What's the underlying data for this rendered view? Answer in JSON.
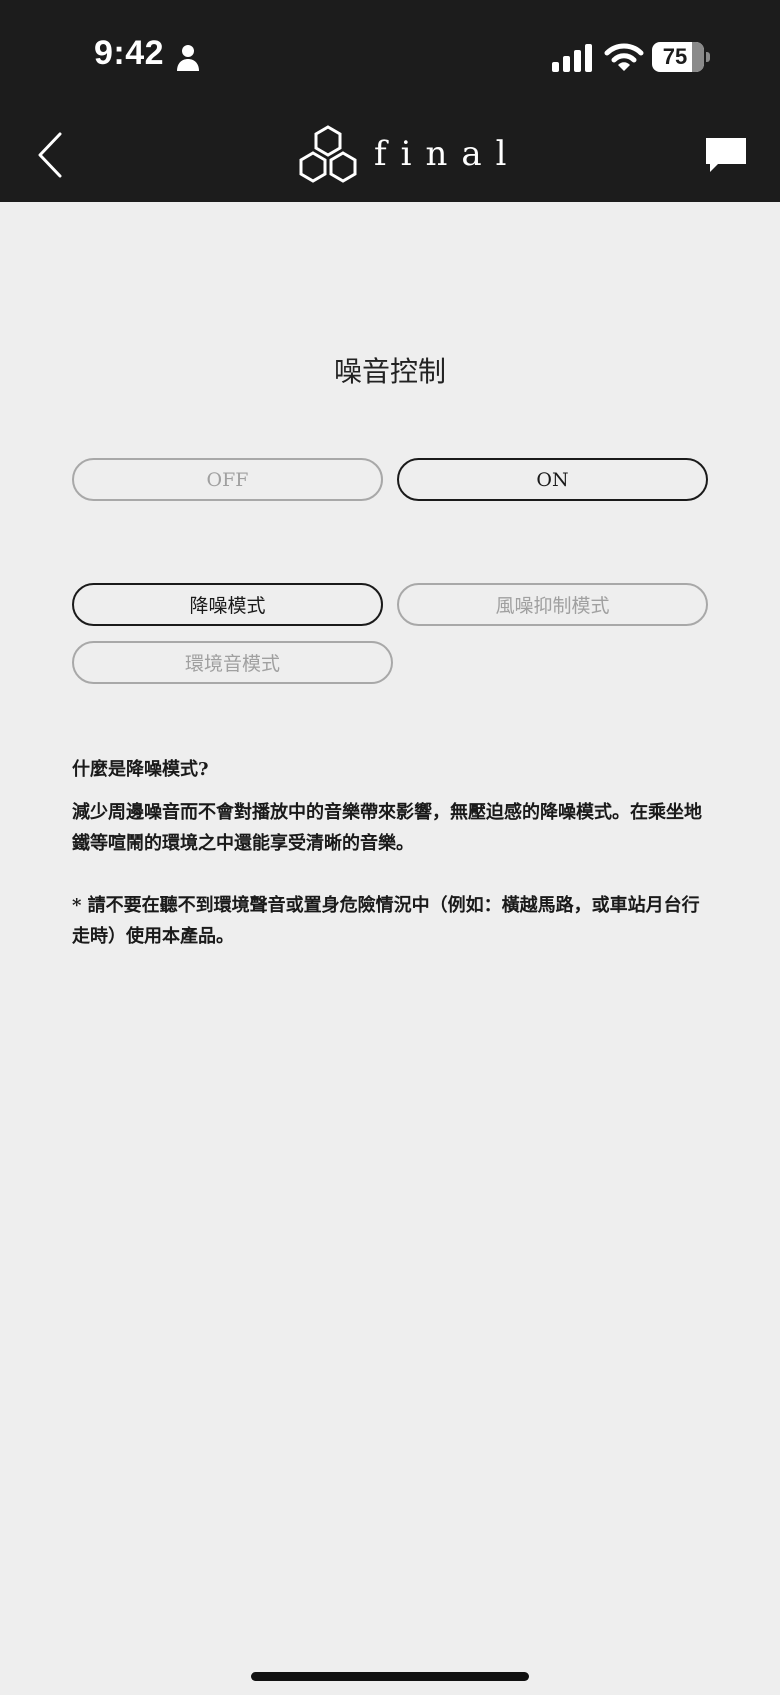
{
  "status_bar": {
    "time": "9:42",
    "battery_level": "75",
    "icons": [
      "person-icon",
      "signal-icon",
      "wifi-icon",
      "battery-icon"
    ]
  },
  "header": {
    "logo_text": "final",
    "back_icon": "chevron-left-icon",
    "chat_icon": "chat-bubble-icon"
  },
  "main": {
    "title": "噪音控制",
    "power_toggle": {
      "off_label": "OFF",
      "on_label": "ON",
      "selected": "ON"
    },
    "modes": [
      {
        "label": "降噪模式",
        "selected": true
      },
      {
        "label": "風噪抑制模式",
        "selected": false
      },
      {
        "label": "環境音模式",
        "selected": false
      }
    ],
    "info": {
      "heading": "什麼是降噪模式?",
      "body": "減少周邊噪音而不會對播放中的音樂帶來影響，無壓迫感的降噪模式。在乘坐地鐵等喧鬧的環境之中還能享受清晰的音樂。",
      "warning": "* 請不要在聽不到環境聲音或置身危險情況中（例如：橫越馬路，或車站月台行走時）使用本產品。"
    }
  },
  "colors": {
    "header_bg": "#1c1c1c",
    "page_bg": "#eeeeee",
    "active_border": "#1a1a1a",
    "inactive_border": "#a8a8a8",
    "inactive_text": "#a0a0a0"
  }
}
